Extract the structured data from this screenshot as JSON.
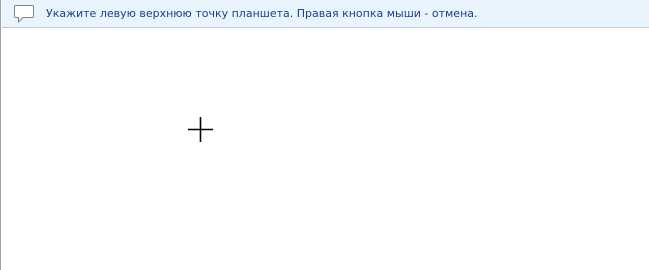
{
  "hint": {
    "text": "Укажите левую верхнюю точку планшета. Правая кнопка мыши - отмена.",
    "icon": "speech-bubble-icon"
  },
  "cursor": {
    "icon": "crosshair-cursor-icon"
  },
  "colors": {
    "hint_background": "#eaf4fd",
    "hint_text": "#1b3f8c",
    "canvas_background": "#ffffff"
  }
}
